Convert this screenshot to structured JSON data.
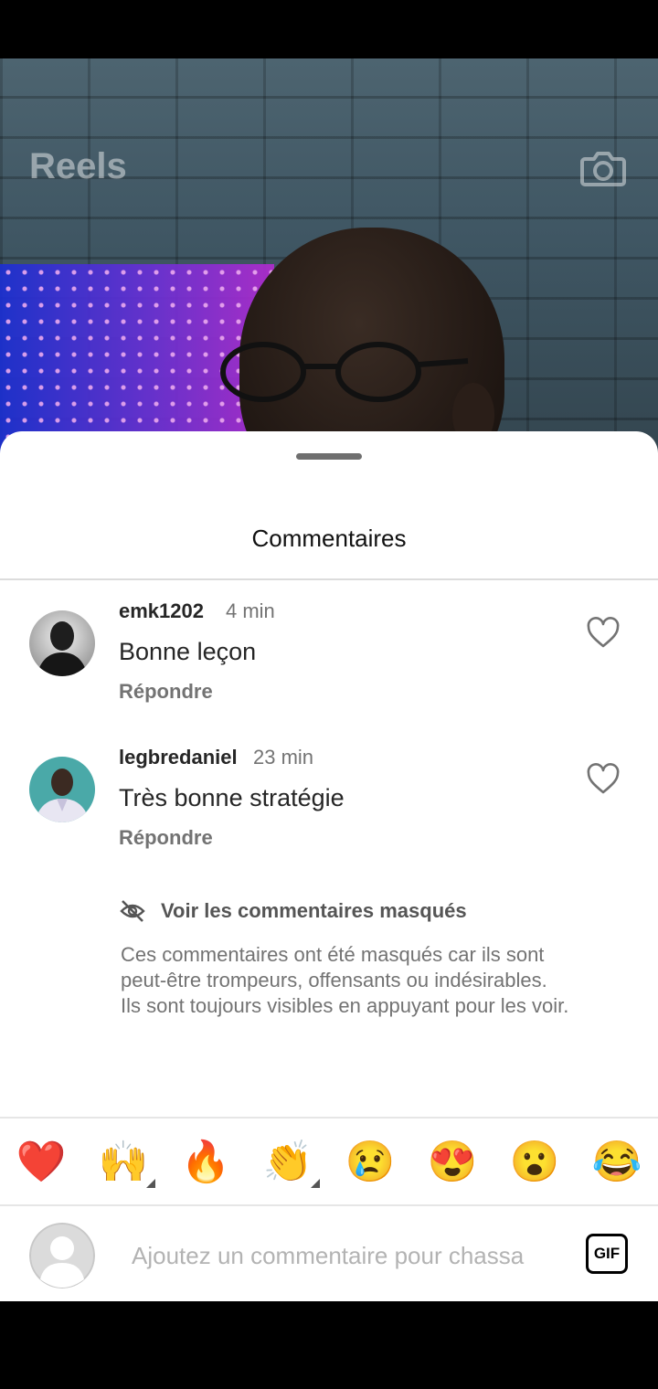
{
  "header": {
    "title": "Reels",
    "camera_icon": "camera-icon"
  },
  "sheet": {
    "title": "Commentaires",
    "comments": [
      {
        "username": "emk1202",
        "time": "4 min",
        "text": "Bonne leçon",
        "reply_label": "Répondre"
      },
      {
        "username": "legbredaniel",
        "time": "23 min",
        "text": "Très bonne stratégie",
        "reply_label": "Répondre"
      }
    ],
    "hidden": {
      "label": "Voir les commentaires masqués",
      "description_lines": [
        "Ces commentaires ont été masqués car ils sont",
        "peut-être trompeurs, offensants ou indésirables.",
        "Ils sont toujours visibles en appuyant pour les voir."
      ]
    }
  },
  "emoji_bar": {
    "emojis": [
      "❤️",
      "🙌",
      "🔥",
      "👏",
      "😢",
      "😍",
      "😮",
      "😂"
    ]
  },
  "composer": {
    "placeholder": "Ajoutez un commentaire pour chassa",
    "gif_label": "GIF"
  },
  "colors": {
    "heart": "#e0243a",
    "text_primary": "#262626",
    "text_secondary": "#737373"
  }
}
